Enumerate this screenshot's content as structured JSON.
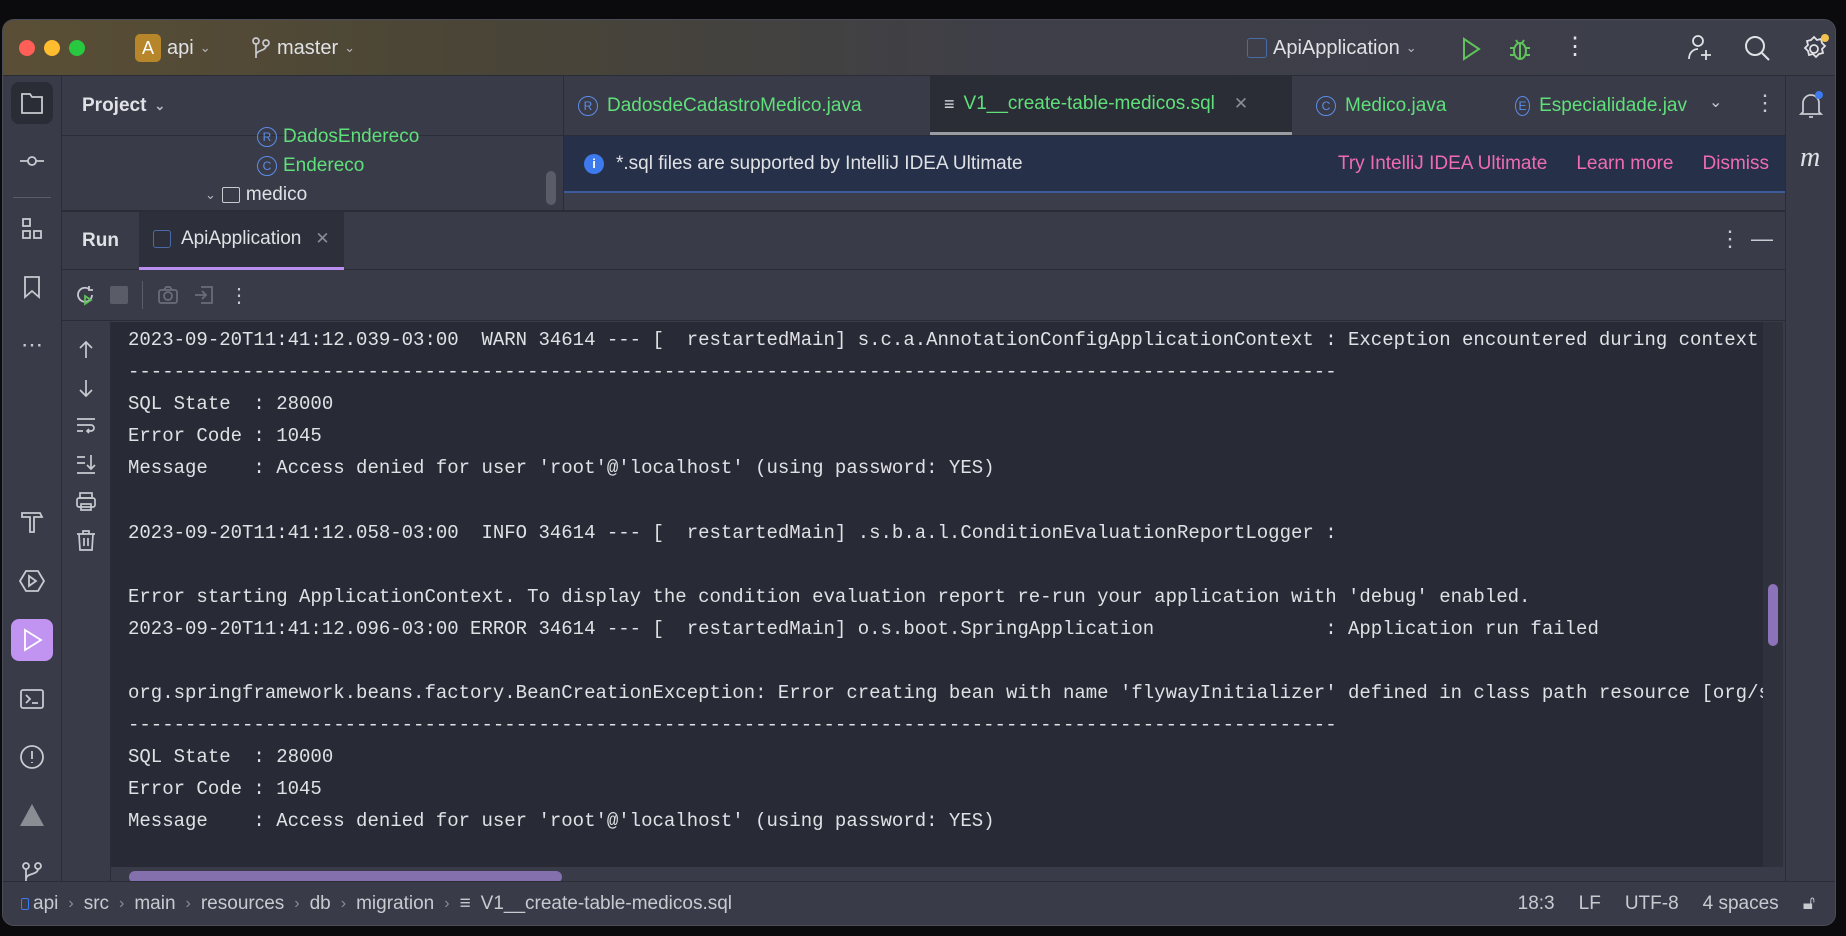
{
  "titlebar": {
    "project_badge": "A",
    "project": "api",
    "branch": "master",
    "run_config": "ApiApplication",
    "icons": [
      "git-branch-icon",
      "run-icon",
      "debug-icon",
      "more-icon",
      "add-user-icon",
      "search-icon",
      "settings-icon"
    ]
  },
  "project_panel": {
    "title": "Project",
    "items": [
      {
        "label": "DadosEndereco",
        "badge": "R"
      },
      {
        "label": "Endereco",
        "badge": "C"
      },
      {
        "label": "medico",
        "type": "folder"
      }
    ]
  },
  "editor_tabs": [
    {
      "label": "DadosdeCadastroMedico.java",
      "badge": "R",
      "active": false
    },
    {
      "label": "V1__create-table-medicos.sql",
      "badge": "sql",
      "active": true
    },
    {
      "label": "Medico.java",
      "badge": "C",
      "active": false
    },
    {
      "label": "Especialidade.jav",
      "badge": "E",
      "active": false
    }
  ],
  "banner": {
    "message": "*.sql files are supported by IntelliJ IDEA Ultimate",
    "try": "Try IntelliJ IDEA Ultimate",
    "learn": "Learn more",
    "dismiss": "Dismiss"
  },
  "run_panel": {
    "title": "Run",
    "tab": "ApiApplication",
    "console_lines": [
      "2023-09-20T11:41:12.039-03:00  WARN 34614 --- [  restartedMain] s.c.a.AnnotationConfigApplicationContext : Exception encountered during context",
      "----------------------------------------------------------------------------------------------------------",
      "SQL State  : 28000",
      "Error Code : 1045",
      "Message    : Access denied for user 'root'@'localhost' (using password: YES)",
      "",
      "2023-09-20T11:41:12.058-03:00  INFO 34614 --- [  restartedMain] .s.b.a.l.ConditionEvaluationReportLogger :",
      "",
      "Error starting ApplicationContext. To display the condition evaluation report re-run your application with 'debug' enabled.",
      "2023-09-20T11:41:12.096-03:00 ERROR 34614 --- [  restartedMain] o.s.boot.SpringApplication               : Application run failed",
      "",
      "org.springframework.beans.factory.BeanCreationException: Error creating bean with name 'flywayInitializer' defined in class path resource [org/s",
      "----------------------------------------------------------------------------------------------------------",
      "SQL State  : 28000",
      "Error Code : 1045",
      "Message    : Access denied for user 'root'@'localhost' (using password: YES)"
    ]
  },
  "status_bar": {
    "breadcrumbs": [
      "api",
      "src",
      "main",
      "resources",
      "db",
      "migration",
      "V1__create-table-medicos.sql"
    ],
    "position": "18:3",
    "line_ending": "LF",
    "encoding": "UTF-8",
    "indent": "4 spaces"
  },
  "colors": {
    "accent": "#c094f0",
    "file_green": "#5fe07a",
    "link_pink": "#f06bb5",
    "console_bg": "#282a35"
  }
}
